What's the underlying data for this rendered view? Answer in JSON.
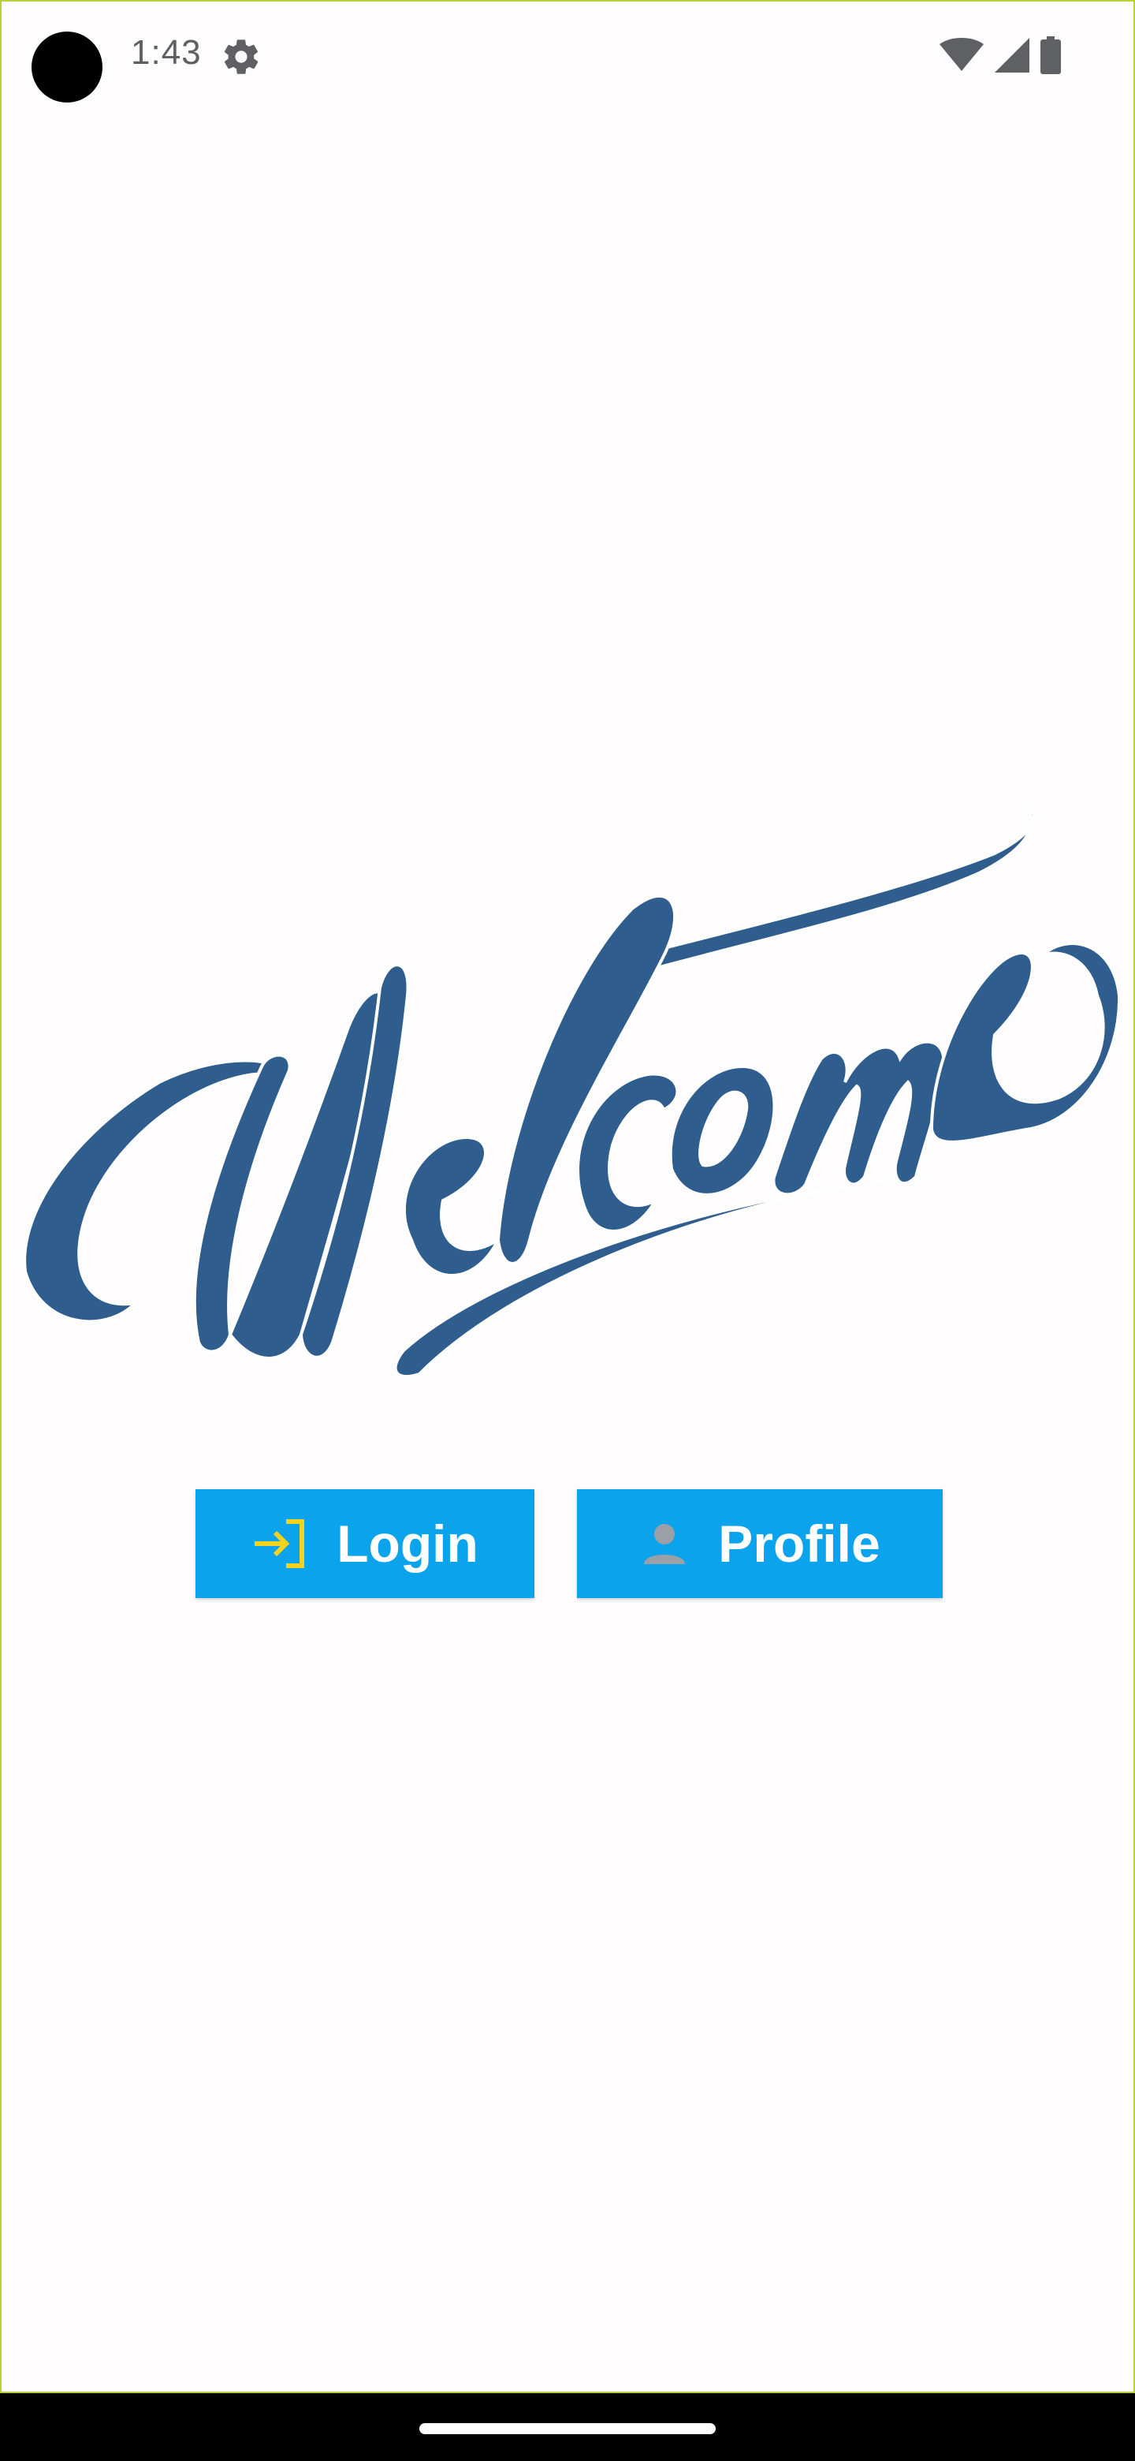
{
  "status_bar": {
    "time": "1:43",
    "icons": [
      "settings-icon",
      "wifi-icon",
      "signal-icon",
      "battery-icon"
    ]
  },
  "hero": {
    "logo_text": "Welcome",
    "logo_color": "#2e5d8e"
  },
  "actions": {
    "login_label": "Login",
    "login_icon": "login-arrow-icon",
    "profile_label": "Profile",
    "profile_icon": "person-icon",
    "button_color": "#0aa3ec",
    "login_icon_color": "#f5d31c",
    "profile_icon_color": "#9aa0a6"
  },
  "nav_bar": {
    "home_indicator": "home-pill"
  }
}
